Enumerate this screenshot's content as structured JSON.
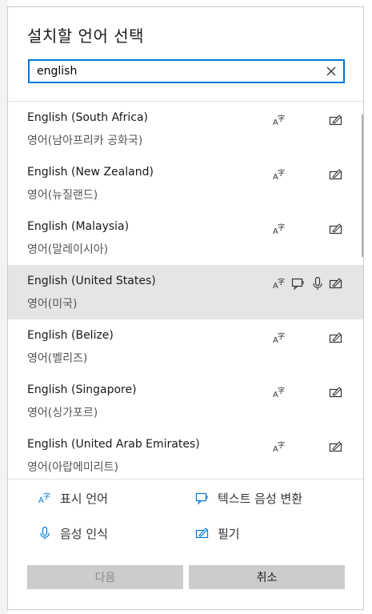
{
  "dialog": {
    "title": "설치할 언어 선택",
    "search": {
      "value": "english",
      "placeholder": ""
    }
  },
  "languages": [
    {
      "name": "English (South Africa)",
      "native": "영어(남아프리카 공화국)",
      "features": [
        "display-language",
        "handwriting"
      ]
    },
    {
      "name": "English (New Zealand)",
      "native": "영어(뉴질랜드)",
      "features": [
        "display-language",
        "handwriting"
      ]
    },
    {
      "name": "English (Malaysia)",
      "native": "영어(말레이시아)",
      "features": [
        "display-language",
        "handwriting"
      ]
    },
    {
      "name": "English (United States)",
      "native": "영어(미국)",
      "features": [
        "display-language",
        "text-to-speech",
        "speech-recognition",
        "handwriting"
      ],
      "selected": true
    },
    {
      "name": "English (Belize)",
      "native": "영어(벨리즈)",
      "features": [
        "display-language",
        "handwriting"
      ]
    },
    {
      "name": "English (Singapore)",
      "native": "영어(싱가포르)",
      "features": [
        "display-language",
        "handwriting"
      ]
    },
    {
      "name": "English (United Arab Emirates)",
      "native": "영어(아랍에미리트)",
      "features": [
        "display-language",
        "handwriting"
      ]
    }
  ],
  "legend": {
    "display_language": "표시 언어",
    "text_to_speech": "텍스트 음성 변환",
    "speech_recognition": "음성 인식",
    "handwriting": "필기"
  },
  "buttons": {
    "next": "다음",
    "cancel": "취소"
  },
  "colors": {
    "accent": "#0078d7",
    "selected_row": "#e5e5e5",
    "button_bg": "#cccccc"
  }
}
